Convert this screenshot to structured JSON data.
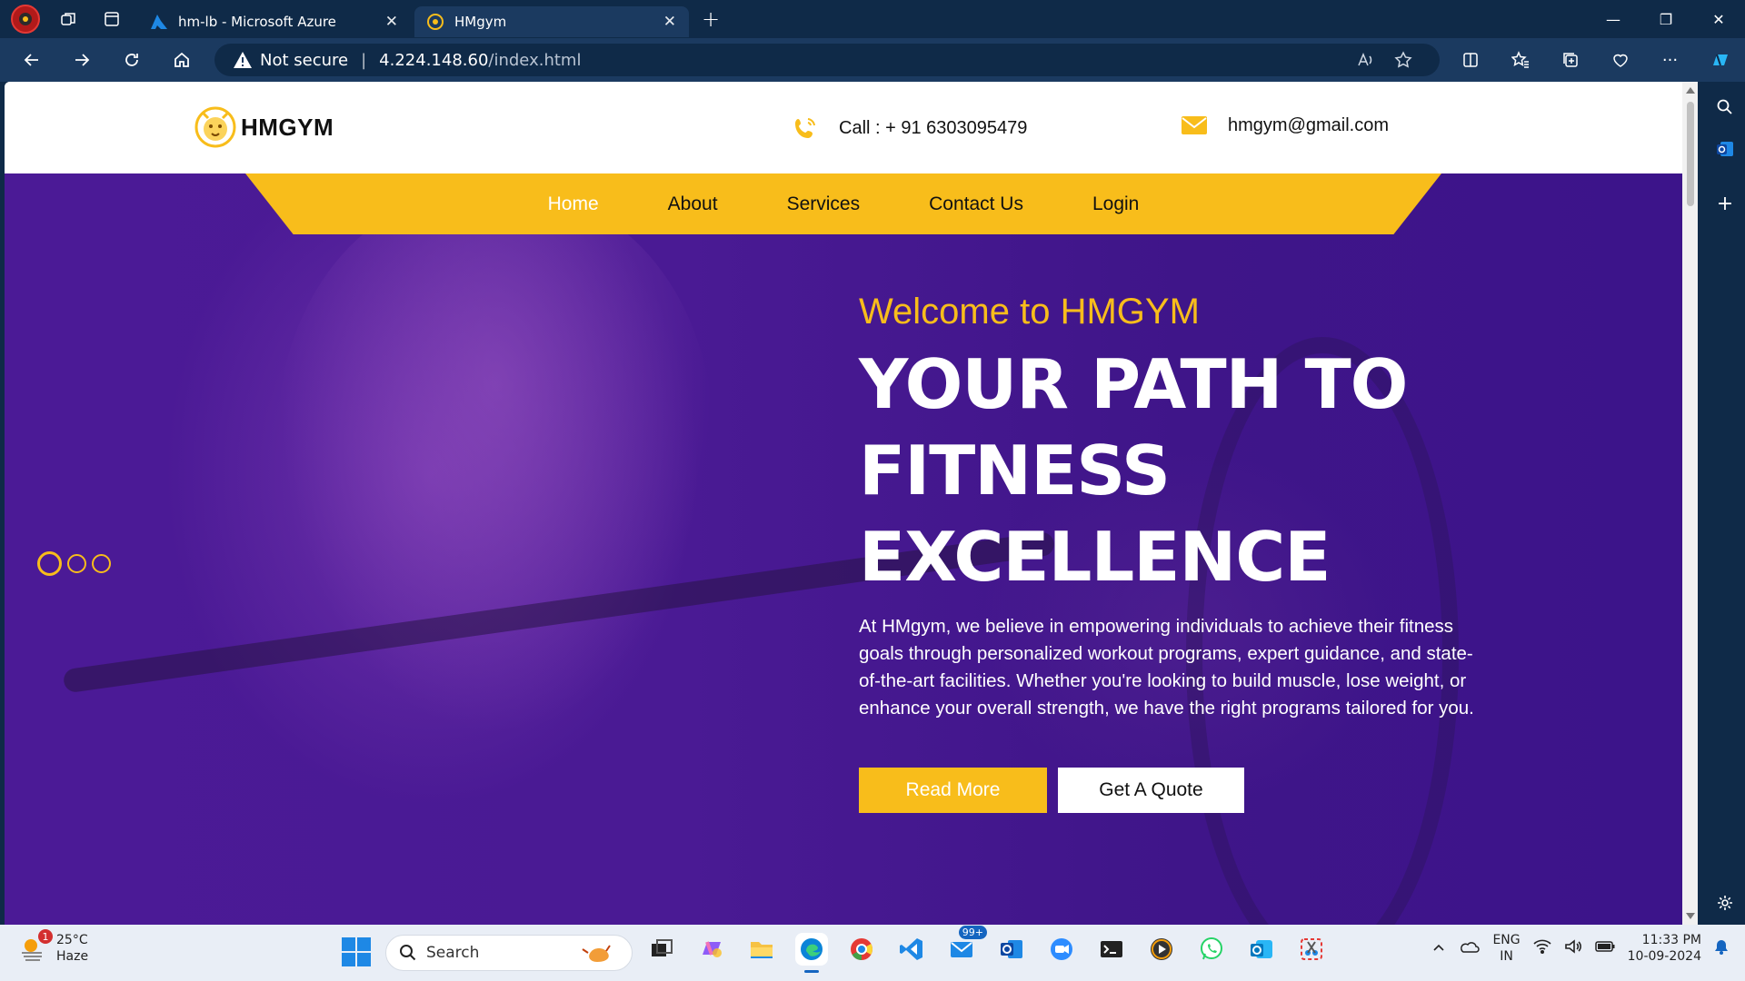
{
  "browser": {
    "tabs": [
      {
        "title": "hm-lb - Microsoft Azure",
        "icon": "azure-icon"
      },
      {
        "title": "HMgym",
        "icon": "gym-favicon"
      }
    ],
    "address": {
      "security": "Not secure",
      "host": "4.224.148.60",
      "path": "/index.html"
    }
  },
  "site": {
    "brand": "HMGYM",
    "phone": "Call : + 91 6303095479",
    "email": "hmgym@gmail.com",
    "nav": [
      "Home",
      "About",
      "Services",
      "Contact Us",
      "Login"
    ],
    "active_nav": "Home",
    "hero": {
      "welcome": "Welcome to HMGYM",
      "headline_1": "YOUR PATH TO",
      "headline_2": "FITNESS",
      "headline_3": "EXCELLENCE",
      "description": "At HMgym, we believe in empowering individuals to achieve their fitness goals through personalized workout programs, expert guidance, and state-of-the-art facilities. Whether you're looking to build muscle, lose weight, or enhance your overall strength, we have the right programs tailored for you.",
      "primary_button": "Read More",
      "secondary_button": "Get A Quote"
    },
    "colors": {
      "accent": "#f8bd1b",
      "hero_bg": "#4a1a94"
    }
  },
  "taskbar": {
    "weather": {
      "temp": "25°C",
      "condition": "Haze",
      "badge": "1"
    },
    "search_placeholder": "Search",
    "mail_badge": "99+",
    "language_1": "ENG",
    "language_2": "IN",
    "time": "11:33 PM",
    "date": "10-09-2024"
  }
}
